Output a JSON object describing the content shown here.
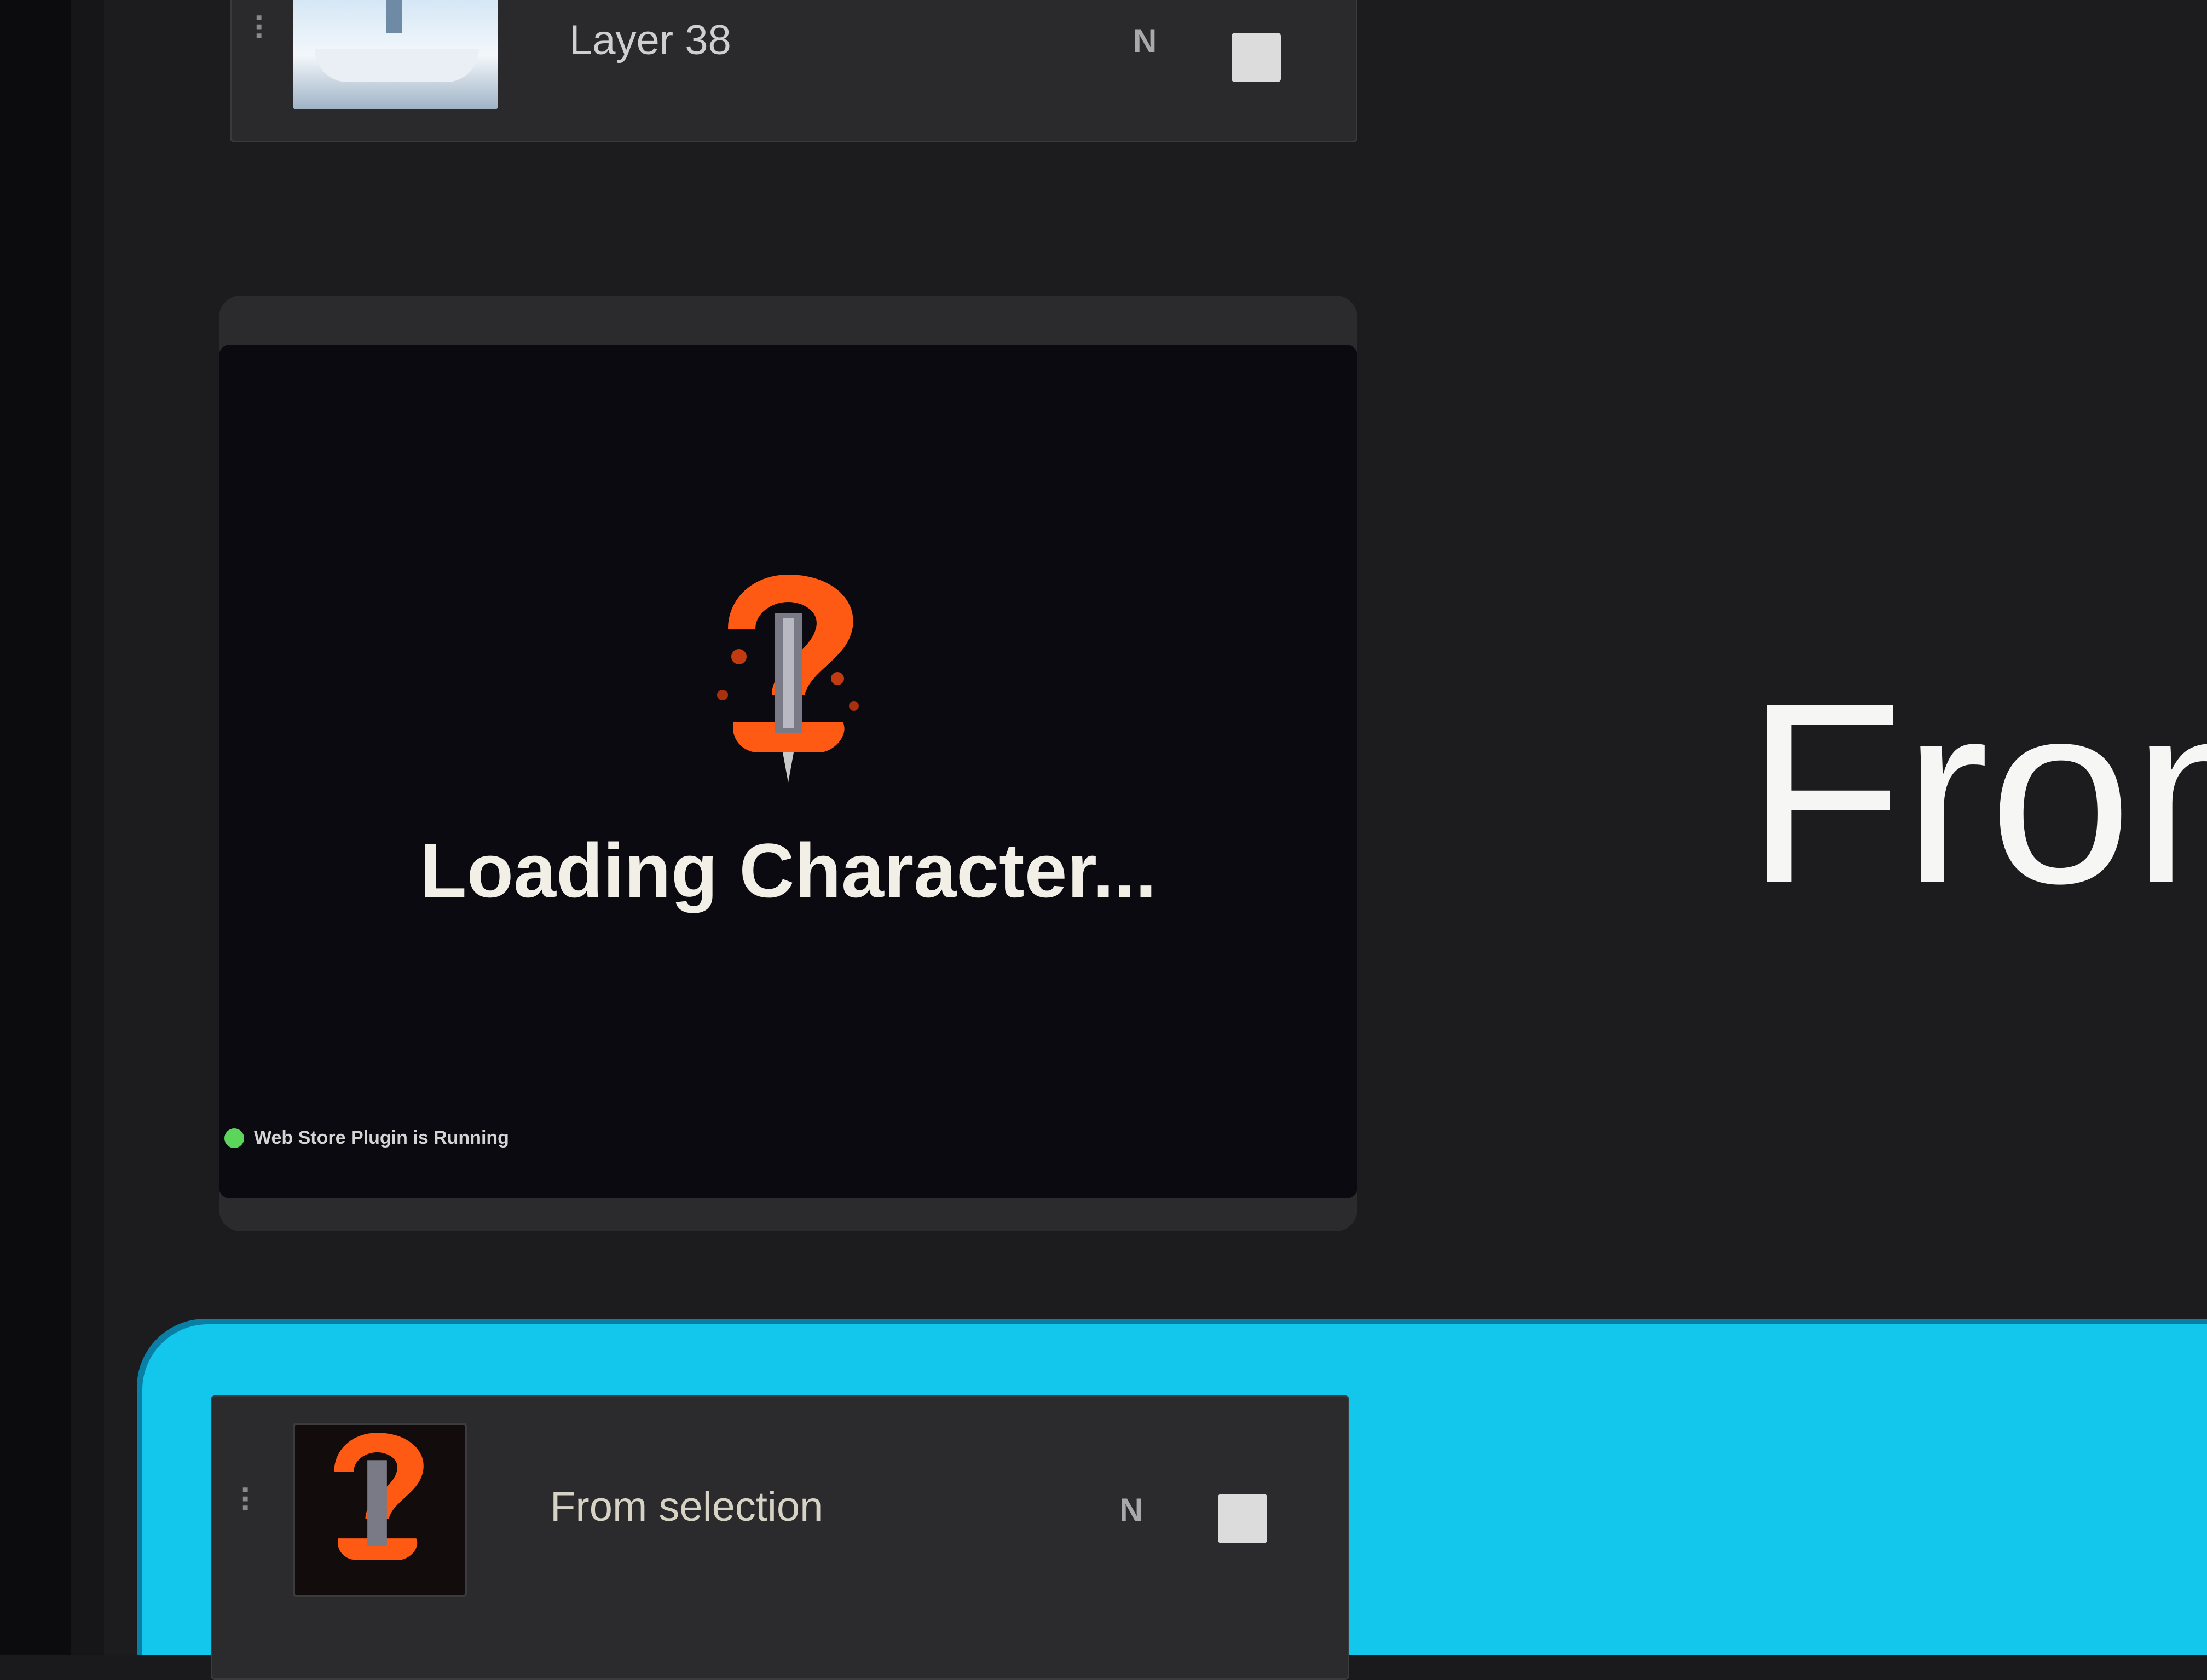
{
  "layers": [
    {
      "name": "Layer 38",
      "blend_mode": "N",
      "handle": "⠇"
    },
    {
      "name": "From selection",
      "blend_mode": "N",
      "handle": "⠇"
    }
  ],
  "preview": {
    "loading_text": "Loading Character...",
    "status_text": "Web Store Plugin is Running"
  },
  "main": {
    "title": "From"
  },
  "colors": {
    "selection": "#12c6ec",
    "loader": "#ff5a14",
    "status_dot": "#5bd65b"
  },
  "icons": {
    "loader": "loader-spinner-icon",
    "visibility": "visibility-icon"
  }
}
